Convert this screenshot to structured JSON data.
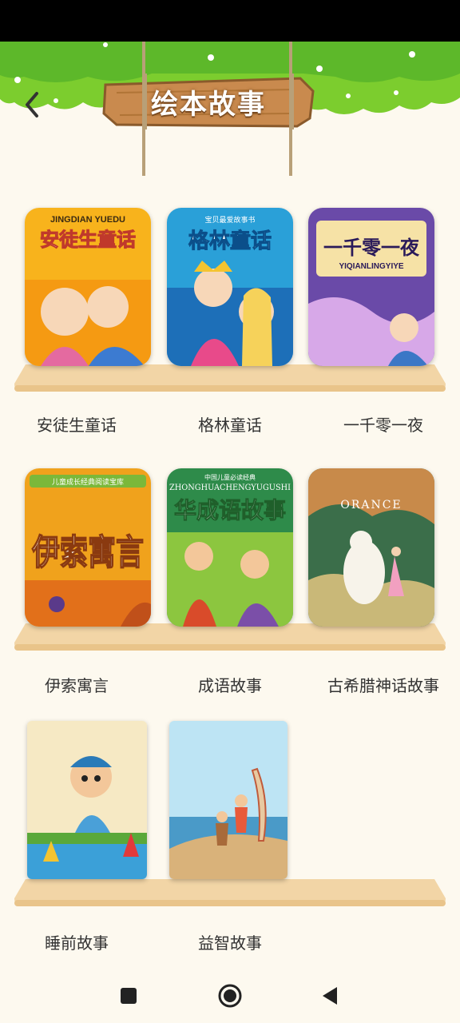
{
  "header": {
    "title": "绘本故事"
  },
  "books": [
    {
      "label": "安徒生童话",
      "cover_title": "安徒生童话",
      "cover_pinyin": "JINGDIAN YUEDU",
      "colors": [
        "#f8b31c",
        "#f59a12"
      ]
    },
    {
      "label": "格林童话",
      "cover_title": "格林童话",
      "cover_subtitle": "宝贝最爱故事书",
      "colors": [
        "#2aa0d8",
        "#1d6fb8"
      ]
    },
    {
      "label": "一千零一夜",
      "cover_title": "一千零一夜",
      "cover_pinyin": "YIQIANLINGYIYE",
      "colors": [
        "#6a4aa8",
        "#f0c04a"
      ]
    },
    {
      "label": "伊索寓言",
      "cover_title": "伊索寓言",
      "cover_subtitle": "儿童成长经典阅读宝库",
      "colors": [
        "#f0a21c",
        "#e2701a"
      ]
    },
    {
      "label": "成语故事",
      "cover_title": "华成语故事",
      "cover_pinyin": "ZHONGHUACHENGYUGUSHI",
      "cover_subtitle": "中国儿童必读经典",
      "colors": [
        "#2e8b4a",
        "#8cc63f"
      ]
    },
    {
      "label": "古希腊神话故事",
      "cover_title": "ORANCE",
      "colors": [
        "#3b6e4a",
        "#c88a4a"
      ]
    },
    {
      "label": "睡前故事",
      "colors": [
        "#f6e9c4",
        "#3ba0d8"
      ]
    },
    {
      "label": "益智故事",
      "colors": [
        "#bde4f4",
        "#d9b27a"
      ]
    }
  ],
  "nav": {
    "recent_icon": "square-icon",
    "home_icon": "circle-icon",
    "back_icon": "triangle-back-icon"
  }
}
